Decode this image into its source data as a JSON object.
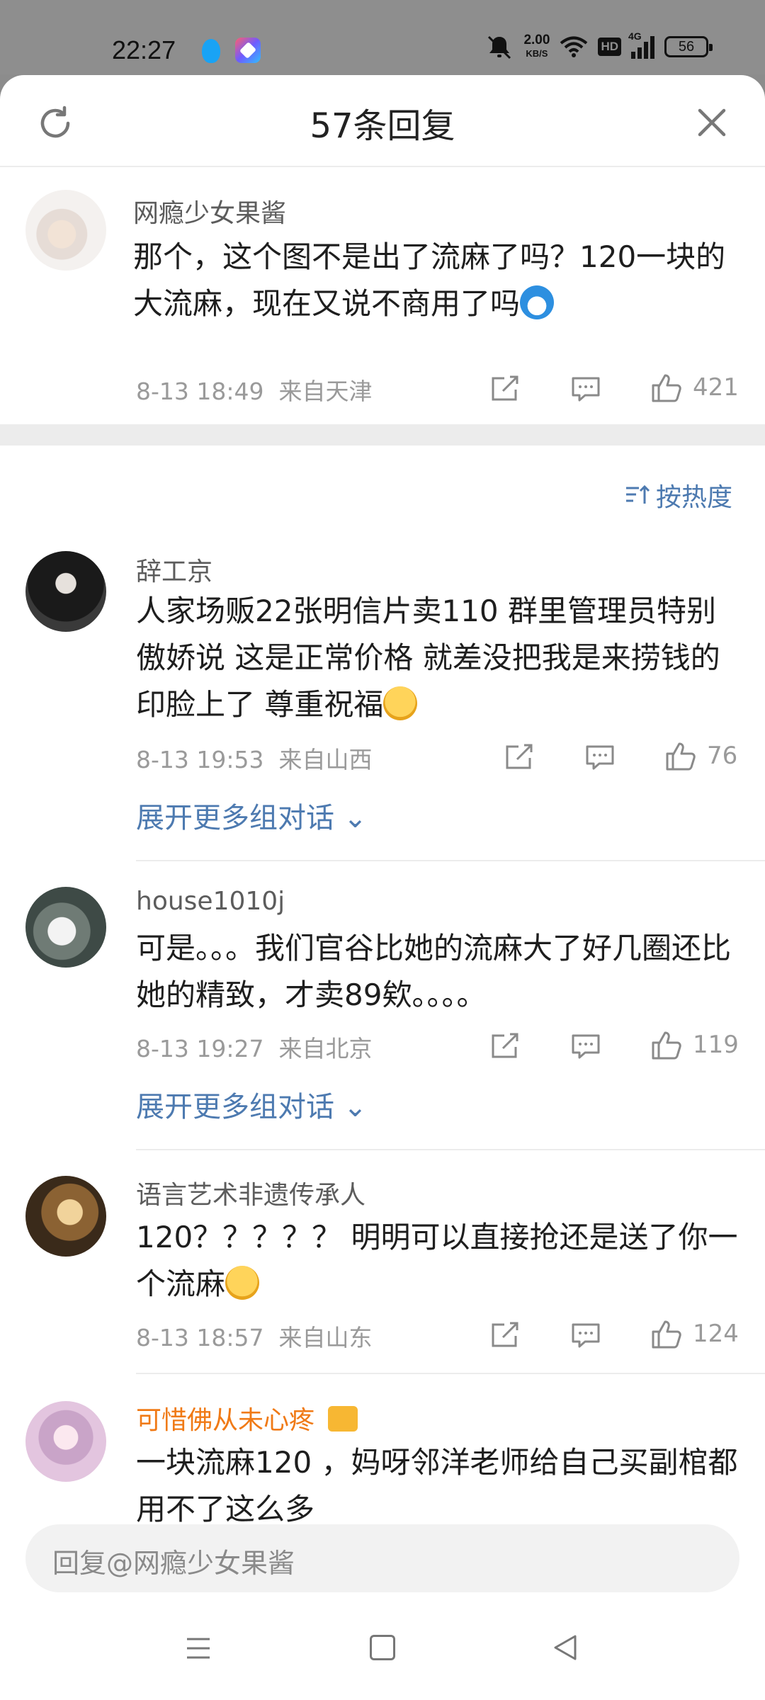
{
  "status_bar": {
    "time": "22:27",
    "net_speed": "2.00",
    "net_unit": "KB/S",
    "hd": "HD",
    "signal_label": "4G",
    "battery": "56"
  },
  "header": {
    "title": "57条回复",
    "refresh_icon": "refresh-icon",
    "close_icon": "close-icon"
  },
  "main_comment": {
    "username": "网瘾少女果酱",
    "text": "那个，这个图不是出了流麻了吗？120一块的大流麻，现在又说不商用了吗",
    "date": "8-13 18:49",
    "location": "来自天津",
    "likes": "421"
  },
  "sort_label": "按热度",
  "replies": [
    {
      "username": "辞工京",
      "text": "人家场贩22张明信片卖110 群里管理员特别傲娇说 这是正常价格 就差没把我是来捞钱的印脸上了 尊重祝福",
      "date": "8-13 19:53",
      "location": "来自山西",
      "likes": "76",
      "expand": "展开更多组对话"
    },
    {
      "username": "house1010j",
      "text": "可是。。。我们官谷比她的流麻大了好几圈还比她的精致，才卖89欸。。。。",
      "date": "8-13 19:27",
      "location": "来自北京",
      "likes": "119",
      "expand": "展开更多组对话"
    },
    {
      "username": "语言艺术非遗传承人",
      "text": "120？？？？？ 明明可以直接抢还是送了你一个流麻",
      "date": "8-13 18:57",
      "location": "来自山东",
      "likes": "124"
    },
    {
      "username": "可惜佛从未心疼",
      "text": "一块流麻120 ，妈呀邻洋老师给自己买副棺都用不了这么多"
    }
  ],
  "reply_input": {
    "placeholder": "回复@网瘾少女果酱"
  },
  "colors": {
    "link_blue": "#4d7ab0",
    "vip_orange": "#f07a16",
    "meta_gray": "#9a9a9a"
  }
}
